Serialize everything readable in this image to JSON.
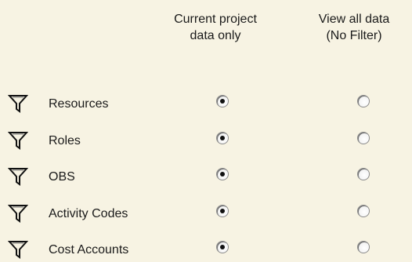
{
  "columns": {
    "current": {
      "line1": "Current project",
      "line2": "data only"
    },
    "all": {
      "line1": "View all data",
      "line2": "(No Filter)"
    }
  },
  "rows": [
    {
      "label": "Resources",
      "selected": "current"
    },
    {
      "label": "Roles",
      "selected": "current"
    },
    {
      "label": "OBS",
      "selected": "current"
    },
    {
      "label": "Activity Codes",
      "selected": "current"
    },
    {
      "label": "Cost Accounts",
      "selected": "current"
    }
  ],
  "icons": {
    "row_icon": "filter-icon"
  },
  "colors": {
    "background": "#f7f3e3"
  }
}
